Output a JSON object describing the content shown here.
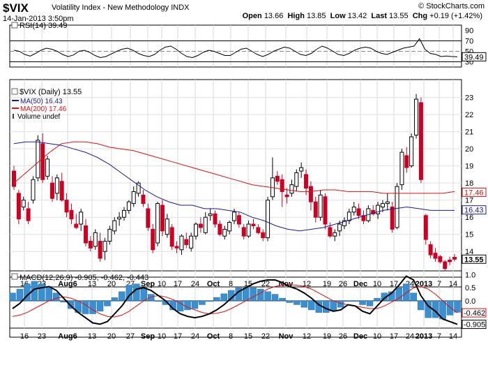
{
  "header": {
    "symbol": "$VIX",
    "description": "Volatility Index - New Methodology INDX",
    "date": "14-Jan-2013 3:50pm",
    "logo": "© StockCharts.com",
    "open_label": "Open",
    "open": "13.66",
    "high_label": "High",
    "high": "13.85",
    "low_label": "Low",
    "low": "13.42",
    "last_label": "Last",
    "last": "13.55",
    "chg_label": "Chg",
    "chg": "+0.19 (+1.42%)"
  },
  "colors": {
    "up": "#000000",
    "down": "#cc0022",
    "ma50": "#1a1a99",
    "ma200": "#dd1111",
    "macd": "#000000",
    "signal": "#dd1111",
    "hist": "#3a8fd0"
  },
  "chart_data": [
    {
      "type": "line",
      "panel": "rsi",
      "title": "RSI(14) 39.49",
      "yticks": [
        "90",
        "70",
        "50",
        "30"
      ],
      "ylim": [
        20,
        100
      ],
      "reference_lines": [
        70,
        50,
        30
      ],
      "last_label": "39.49",
      "values": [
        52,
        50,
        44,
        41,
        46,
        52,
        56,
        54,
        50,
        44,
        40,
        43,
        50,
        52,
        48,
        42,
        38,
        40,
        45,
        50,
        54,
        56,
        52,
        46,
        42,
        40,
        44,
        52,
        58,
        60,
        54,
        46,
        40,
        38,
        42,
        48,
        52,
        50,
        46,
        42,
        42,
        48,
        54,
        56,
        50,
        44,
        40,
        44,
        50,
        54,
        58,
        56,
        50,
        44,
        42,
        46,
        54,
        60,
        56,
        50,
        44,
        42,
        46,
        52,
        56,
        58,
        56,
        50,
        46,
        44,
        48,
        52,
        56,
        58,
        60,
        74,
        54,
        46,
        44,
        40,
        41,
        40,
        39.49
      ]
    },
    {
      "type": "candlestick",
      "panel": "price",
      "title": "$VIX (Daily) 13.55",
      "legend": [
        "MA(50) 16.43",
        "MA(200) 17.46",
        "Volume undef"
      ],
      "yticks": [
        "23",
        "22",
        "21",
        "20",
        "19",
        "18",
        "17",
        "16",
        "15",
        "14"
      ],
      "ylim": [
        12.5,
        23.8
      ],
      "last_price": "13.55",
      "ma50_label": "16.43",
      "ma200_label": "17.46",
      "ohlc": [
        [
          18.7,
          19.0,
          17.6,
          17.8
        ],
        [
          17.4,
          17.6,
          15.6,
          15.9
        ],
        [
          16.6,
          17.2,
          16.4,
          17.0
        ],
        [
          16.5,
          16.9,
          15.6,
          15.8
        ],
        [
          17.0,
          18.4,
          16.8,
          18.2
        ],
        [
          18.3,
          20.8,
          18.1,
          20.5
        ],
        [
          20.3,
          20.9,
          18.0,
          18.2
        ],
        [
          18.4,
          19.6,
          18.2,
          19.4
        ],
        [
          18.0,
          18.4,
          16.9,
          17.1
        ],
        [
          17.4,
          18.5,
          17.0,
          18.3
        ],
        [
          18.1,
          18.6,
          16.9,
          17.0
        ],
        [
          17.0,
          17.4,
          16.0,
          16.3
        ],
        [
          16.4,
          16.8,
          15.6,
          15.9
        ],
        [
          15.6,
          16.2,
          15.3,
          15.4
        ],
        [
          15.6,
          16.5,
          15.2,
          16.3
        ],
        [
          15.5,
          15.9,
          14.3,
          14.5
        ],
        [
          14.6,
          14.9,
          14.0,
          14.2
        ],
        [
          14.3,
          15.3,
          14.1,
          15.1
        ],
        [
          14.6,
          15.1,
          13.4,
          13.6
        ],
        [
          14.0,
          14.8,
          13.5,
          14.6
        ],
        [
          14.6,
          15.5,
          14.4,
          15.3
        ],
        [
          15.2,
          16.0,
          15.0,
          15.8
        ],
        [
          15.9,
          16.3,
          15.5,
          16.0
        ],
        [
          16.0,
          16.6,
          15.8,
          16.4
        ],
        [
          16.4,
          17.0,
          16.2,
          16.9
        ],
        [
          16.8,
          17.8,
          16.6,
          17.5
        ],
        [
          17.4,
          18.1,
          17.2,
          18.0
        ],
        [
          17.3,
          17.6,
          16.6,
          16.8
        ],
        [
          16.5,
          16.8,
          15.2,
          15.4
        ],
        [
          15.3,
          15.6,
          13.9,
          14.1
        ],
        [
          14.5,
          16.9,
          14.3,
          16.8
        ],
        [
          16.7,
          17.0,
          14.9,
          15.2
        ],
        [
          15.0,
          16.2,
          14.8,
          15.9
        ],
        [
          15.4,
          15.6,
          14.1,
          14.3
        ],
        [
          14.3,
          14.6,
          13.9,
          14.2
        ],
        [
          14.1,
          15.0,
          13.8,
          14.9
        ],
        [
          14.7,
          15.1,
          14.2,
          14.4
        ],
        [
          14.2,
          15.1,
          14.0,
          14.9
        ],
        [
          14.9,
          15.7,
          14.7,
          15.6
        ],
        [
          15.6,
          16.0,
          15.1,
          15.4
        ],
        [
          15.1,
          16.3,
          15.0,
          16.0
        ],
        [
          16.1,
          16.5,
          15.8,
          16.2
        ],
        [
          16.2,
          16.4,
          15.4,
          15.6
        ],
        [
          15.6,
          15.8,
          14.9,
          15.0
        ],
        [
          14.9,
          15.5,
          14.7,
          15.3
        ],
        [
          15.2,
          15.8,
          15.0,
          15.7
        ],
        [
          15.8,
          16.5,
          15.6,
          16.3
        ],
        [
          16.1,
          16.3,
          15.4,
          15.6
        ],
        [
          15.4,
          15.6,
          14.7,
          14.9
        ],
        [
          14.9,
          15.8,
          14.8,
          15.6
        ],
        [
          15.6,
          15.9,
          15.3,
          15.5
        ],
        [
          15.4,
          15.6,
          15.0,
          15.1
        ],
        [
          15.1,
          15.3,
          14.6,
          14.8
        ],
        [
          14.8,
          17.2,
          14.6,
          17.0
        ],
        [
          17.2,
          19.5,
          17.0,
          18.3
        ],
        [
          18.4,
          18.7,
          17.9,
          18.1
        ],
        [
          18.2,
          18.5,
          16.6,
          17.5
        ],
        [
          17.3,
          17.7,
          16.8,
          17.2
        ],
        [
          17.4,
          18.2,
          17.2,
          17.9
        ],
        [
          17.8,
          18.8,
          17.5,
          18.6
        ],
        [
          18.7,
          19.2,
          18.3,
          18.9
        ],
        [
          18.5,
          18.8,
          17.3,
          17.7
        ],
        [
          17.8,
          18.1,
          16.4,
          16.9
        ],
        [
          16.9,
          17.2,
          15.7,
          16.0
        ],
        [
          16.0,
          17.6,
          15.8,
          17.3
        ],
        [
          17.2,
          17.4,
          15.3,
          15.6
        ],
        [
          15.4,
          15.7,
          14.8,
          14.9
        ],
        [
          14.9,
          15.3,
          14.6,
          15.1
        ],
        [
          15.2,
          15.8,
          14.9,
          15.6
        ],
        [
          15.5,
          16.0,
          15.3,
          15.8
        ],
        [
          15.8,
          16.5,
          15.6,
          16.3
        ],
        [
          16.3,
          16.9,
          16.1,
          16.6
        ],
        [
          16.5,
          16.8,
          15.9,
          16.1
        ],
        [
          16.1,
          16.4,
          15.6,
          15.8
        ],
        [
          15.8,
          16.7,
          15.7,
          16.5
        ],
        [
          16.4,
          16.7,
          16.1,
          16.2
        ],
        [
          16.2,
          16.9,
          15.9,
          16.7
        ],
        [
          16.6,
          17.0,
          16.3,
          16.8
        ],
        [
          16.8,
          17.4,
          16.4,
          16.9
        ],
        [
          16.6,
          16.9,
          15.1,
          15.3
        ],
        [
          15.4,
          18.0,
          15.3,
          17.8
        ],
        [
          17.9,
          20.0,
          17.6,
          19.8
        ],
        [
          19.6,
          20.1,
          18.6,
          18.9
        ],
        [
          19.0,
          20.9,
          18.9,
          20.7
        ],
        [
          20.8,
          23.2,
          20.6,
          22.9
        ],
        [
          22.7,
          23.0,
          18.0,
          18.2
        ],
        [
          16.1,
          16.2,
          14.4,
          14.7
        ],
        [
          14.4,
          14.6,
          13.6,
          13.8
        ],
        [
          13.9,
          14.2,
          13.4,
          13.6
        ],
        [
          13.7,
          13.8,
          13.3,
          13.4
        ],
        [
          13.4,
          13.5,
          12.9,
          13.0
        ],
        [
          13.5,
          13.7,
          13.2,
          13.4
        ],
        [
          13.66,
          13.85,
          13.42,
          13.55
        ]
      ],
      "ma50": [
        20.3,
        20.4,
        20.4,
        20.3,
        20.2,
        20.0,
        19.8,
        19.5,
        19.1,
        18.6,
        18.1,
        17.6,
        17.2,
        16.9,
        16.7,
        16.7,
        16.5,
        16.5,
        16.4,
        16.3,
        16.0,
        15.8,
        15.5,
        15.3,
        15.2,
        15.3,
        15.4,
        15.6,
        15.8,
        16.0,
        16.2,
        16.4,
        16.5,
        16.6,
        16.5,
        16.4,
        16.4,
        16.4
      ],
      "ma200": [
        18.0,
        18.6,
        19.2,
        19.8,
        20.3,
        20.4,
        20.4,
        20.3,
        20.1,
        20.0,
        19.9,
        19.7,
        19.5,
        19.3,
        19.1,
        18.9,
        18.7,
        18.5,
        18.3,
        18.1,
        17.9,
        17.8,
        17.7,
        17.6,
        17.5,
        17.5,
        17.6,
        17.6,
        17.5,
        17.5,
        17.5,
        17.4,
        17.4,
        17.4,
        17.4,
        17.4,
        17.4,
        17.5
      ],
      "x_labels_spots": [
        "16",
        "23",
        "Aug6",
        "13",
        "20",
        "27",
        "Sep",
        "10",
        "17",
        "24",
        "Oct",
        "8",
        "15",
        "22",
        "Nov",
        "12",
        "19",
        "26",
        "Dec",
        "10",
        "17",
        "24",
        "2013",
        "7",
        "14"
      ]
    },
    {
      "type": "line",
      "panel": "macd",
      "title": "MACD(12,26,9) -0.905, -0.462, -0.443",
      "yticks": [
        "1.0",
        "0.5",
        "0.0",
        "-0.5"
      ],
      "ylim": [
        -1.05,
        1.15
      ],
      "macd_label": "-0.905",
      "signal_label": "-0.462",
      "macd": [
        -0.3,
        -0.1,
        0.2,
        0.45,
        0.5,
        0.55,
        0.4,
        0.1,
        -0.2,
        -0.45,
        -0.65,
        -0.85,
        -0.9,
        -0.8,
        -0.5,
        -0.2,
        0.2,
        0.45,
        0.5,
        0.4,
        0.2,
        0.0,
        -0.3,
        -0.5,
        -0.6,
        -0.65,
        -0.6,
        -0.5,
        -0.35,
        -0.15,
        0.1,
        0.35,
        0.5,
        0.65,
        0.75,
        0.8,
        0.8,
        0.7,
        0.55,
        0.45,
        0.3,
        0.1,
        -0.15,
        -0.3,
        -0.4,
        -0.35,
        -0.15,
        -0.2,
        -0.4,
        -0.5,
        -0.2,
        0.1,
        0.3,
        0.6,
        0.95,
        0.8,
        0.2,
        -0.2,
        -0.4,
        -0.7,
        -0.8,
        -0.905
      ],
      "signal": [
        -0.6,
        -0.55,
        -0.45,
        -0.3,
        -0.15,
        0.0,
        0.1,
        0.15,
        0.1,
        0.0,
        -0.15,
        -0.35,
        -0.5,
        -0.6,
        -0.62,
        -0.55,
        -0.4,
        -0.2,
        0.0,
        0.15,
        0.2,
        0.15,
        0.05,
        -0.1,
        -0.25,
        -0.35,
        -0.45,
        -0.5,
        -0.48,
        -0.42,
        -0.3,
        -0.15,
        0.0,
        0.15,
        0.3,
        0.45,
        0.55,
        0.6,
        0.62,
        0.6,
        0.55,
        0.45,
        0.3,
        0.15,
        0.0,
        -0.1,
        -0.15,
        -0.2,
        -0.25,
        -0.3,
        -0.3,
        -0.2,
        -0.05,
        0.1,
        0.3,
        0.5,
        0.55,
        0.45,
        0.25,
        0.0,
        -0.25,
        -0.462
      ]
    }
  ]
}
